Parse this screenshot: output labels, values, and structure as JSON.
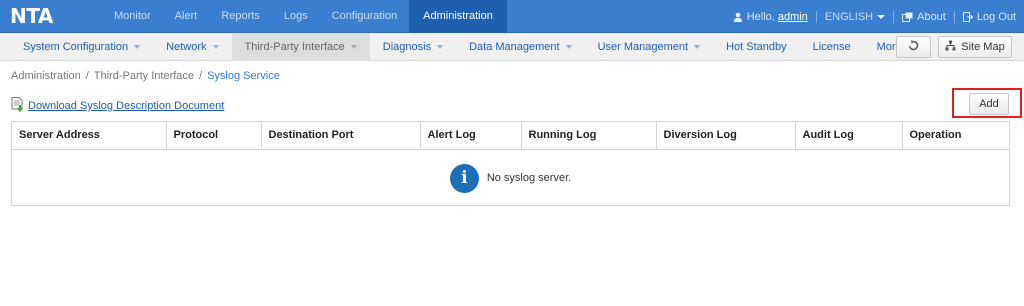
{
  "app": {
    "logo": "NTA"
  },
  "top_nav": [
    {
      "label": "Monitor"
    },
    {
      "label": "Alert"
    },
    {
      "label": "Reports"
    },
    {
      "label": "Logs"
    },
    {
      "label": "Configuration"
    },
    {
      "label": "Administration",
      "active": true
    }
  ],
  "user_bar": {
    "greeting": "Hello,",
    "username": "admin",
    "language": "ENGLISH",
    "about": "About",
    "logout": "Log Out"
  },
  "sub_nav": [
    {
      "label": "System Configuration",
      "dropdown": true
    },
    {
      "label": "Network",
      "dropdown": true
    },
    {
      "label": "Third-Party Interface",
      "dropdown": true,
      "active": true
    },
    {
      "label": "Diagnosis",
      "dropdown": true
    },
    {
      "label": "Data Management",
      "dropdown": true
    },
    {
      "label": "User Management",
      "dropdown": true
    },
    {
      "label": "Hot Standby",
      "dropdown": false
    },
    {
      "label": "License",
      "dropdown": false
    },
    {
      "label": "More",
      "dropdown": true
    }
  ],
  "toolbar": {
    "site_map": "Site Map"
  },
  "breadcrumb": {
    "items": [
      "Administration",
      "/",
      "Third-Party Interface",
      "/"
    ],
    "current": "Syslog Service"
  },
  "download": {
    "label": "Download Syslog Description Document"
  },
  "actions": {
    "add": "Add"
  },
  "table": {
    "columns": [
      "Server Address",
      "Protocol",
      "Destination Port",
      "Alert Log",
      "Running Log",
      "Diversion Log",
      "Audit Log",
      "Operation"
    ],
    "empty_message": "No syslog server."
  },
  "colors": {
    "topbar": "#3a7fcf",
    "active_tab": "#1f5faf",
    "link": "#1c5fb0",
    "highlight": "#e0201c",
    "info": "#1f6fb8"
  }
}
